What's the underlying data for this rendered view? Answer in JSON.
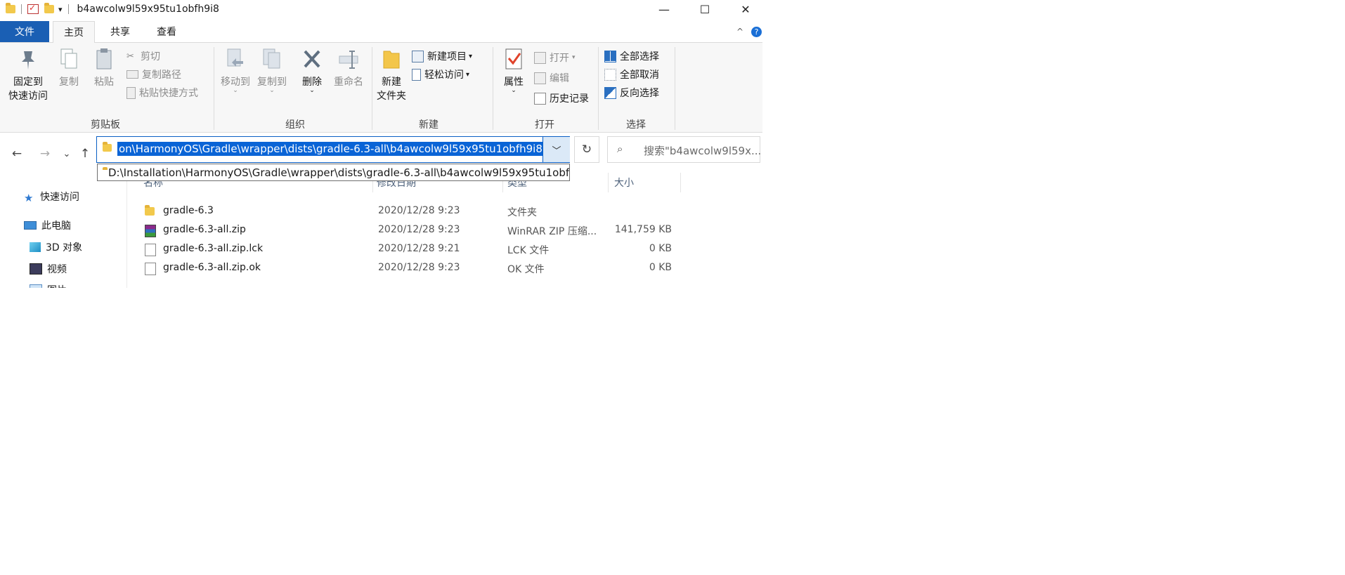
{
  "window": {
    "title": "b4awcolw9l59x95tu1obfh9i8",
    "controls": {
      "minimize": "—",
      "maximize": "☐",
      "close": "✕"
    }
  },
  "quick_access_toolbar": {
    "dropdown": "▾"
  },
  "menu": {
    "file": "文件",
    "tabs": [
      "主页",
      "共享",
      "查看"
    ],
    "active_tab": "主页",
    "collapse": "^",
    "help": "?"
  },
  "ribbon": {
    "clipboard": {
      "label": "剪贴板",
      "pin_line1": "固定到",
      "pin_line2": "快速访问",
      "copy": "复制",
      "paste": "粘贴",
      "cut": "剪切",
      "copy_path": "复制路径",
      "paste_shortcut": "粘贴快捷方式"
    },
    "organize": {
      "label": "组织",
      "move_to": "移动到",
      "copy_to": "复制到",
      "delete": "删除",
      "rename": "重命名"
    },
    "new": {
      "label": "新建",
      "new_folder_line1": "新建",
      "new_folder_line2": "文件夹",
      "new_item": "新建项目",
      "easy_access": "轻松访问"
    },
    "open": {
      "label": "打开",
      "properties": "属性",
      "open": "打开",
      "edit": "编辑",
      "history": "历史记录"
    },
    "select": {
      "label": "选择",
      "select_all": "全部选择",
      "select_none": "全部取消",
      "invert": "反向选择"
    }
  },
  "address": {
    "selected_text": "on\\HarmonyOS\\Gradle\\wrapper\\dists\\gradle-6.3-all\\b4awcolw9l59x95tu1obfh9i8",
    "suggestion": "D:\\Installation\\HarmonyOS\\Gradle\\wrapper\\dists\\gradle-6.3-all\\b4awcolw9l59x95tu1obfh9i8",
    "search_placeholder": "搜索\"b4awcolw9l59x..."
  },
  "nav": {
    "back": "←",
    "forward": "→",
    "recent": "⌄",
    "up": "↑",
    "refresh": "↻",
    "search_glyph": "⌕"
  },
  "navpane": {
    "quick_access": "快速访问",
    "this_pc": "此电脑",
    "objects_3d": "3D 对象",
    "videos": "视频",
    "pictures": "图片"
  },
  "columns": {
    "name": "名称",
    "modified": "修改日期",
    "type": "类型",
    "size": "大小"
  },
  "files": [
    {
      "name": "gradle-6.3",
      "modified": "2020/12/28 9:23",
      "type": "文件夹",
      "size": "",
      "icon": "folder-icon"
    },
    {
      "name": "gradle-6.3-all.zip",
      "modified": "2020/12/28 9:23",
      "type": "WinRAR ZIP 压缩...",
      "size": "141,759 KB",
      "icon": "winrar-zip-icon"
    },
    {
      "name": "gradle-6.3-all.zip.lck",
      "modified": "2020/12/28 9:21",
      "type": "LCK 文件",
      "size": "0 KB",
      "icon": "file-icon"
    },
    {
      "name": "gradle-6.3-all.zip.ok",
      "modified": "2020/12/28 9:23",
      "type": "OK 文件",
      "size": "0 KB",
      "icon": "file-icon"
    }
  ]
}
